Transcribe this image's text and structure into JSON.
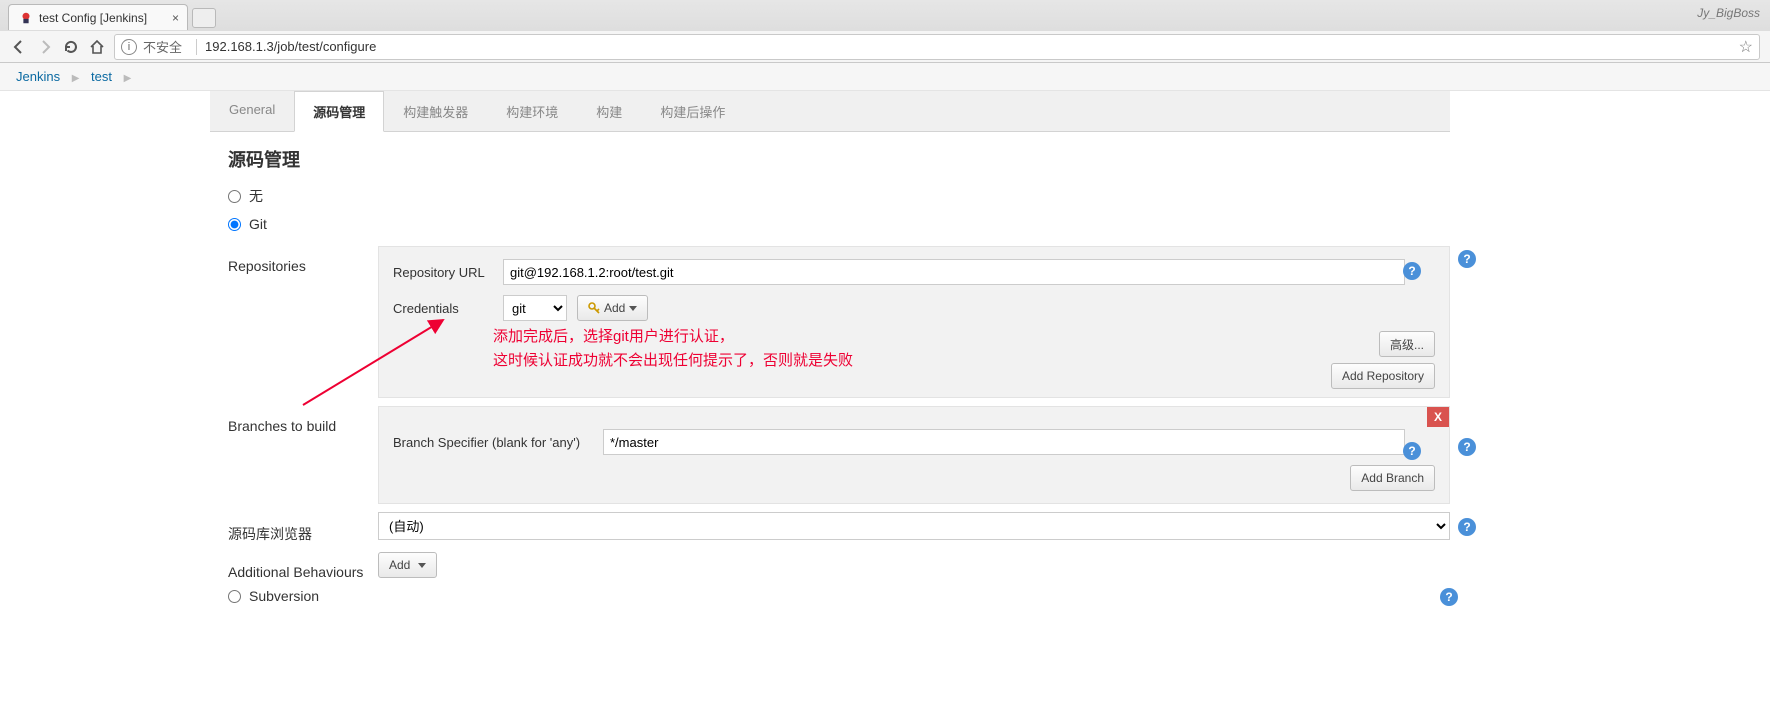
{
  "browser": {
    "tab_title": "test Config [Jenkins]",
    "user_label": "Jy_BigBoss",
    "not_secure": "不安全",
    "url": "192.168.1.3/job/test/configure"
  },
  "breadcrumb": {
    "items": [
      "Jenkins",
      "test"
    ]
  },
  "tabs": {
    "items": [
      "General",
      "源码管理",
      "构建触发器",
      "构建环境",
      "构建",
      "构建后操作"
    ],
    "active_index": 1
  },
  "section": {
    "title": "源码管理",
    "scm_options": {
      "none": "无",
      "git": "Git",
      "svn": "Subversion"
    },
    "selected": "git"
  },
  "repositories": {
    "label": "Repositories",
    "url_label": "Repository URL",
    "url_value": "git@192.168.1.2:root/test.git",
    "cred_label": "Credentials",
    "cred_value": "git",
    "add_btn": "Add",
    "advanced_btn": "高级...",
    "add_repo_btn": "Add Repository"
  },
  "branches": {
    "label": "Branches to build",
    "spec_label": "Branch Specifier (blank for 'any')",
    "spec_value": "*/master",
    "add_branch_btn": "Add Branch"
  },
  "browser_block": {
    "label": "源码库浏览器",
    "value": "(自动)"
  },
  "additional": {
    "label": "Additional Behaviours",
    "add_btn": "Add"
  },
  "annotation": {
    "line1": "添加完成后，选择git用户进行认证，",
    "line2": "这时候认证成功就不会出现任何提示了，否则就是失败"
  }
}
